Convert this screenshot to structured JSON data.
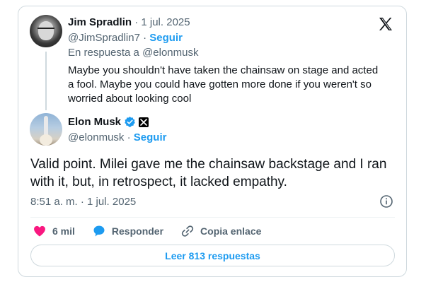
{
  "reply_tweet": {
    "author_name": "Jim Spradlin",
    "separator": "·",
    "date": "1 jul. 2025",
    "handle": "@JimSpradlin7",
    "follow_label": "Seguir",
    "in_reply_to": "En respuesta a @elonmusk",
    "text": "Maybe you shouldn't have taken the chainsaw on stage and acted a fool. Maybe you could have gotten more done if you weren't so worried about looking cool"
  },
  "main_tweet": {
    "author_name": "Elon Musk",
    "handle": "@elonmusk",
    "separator": "·",
    "follow_label": "Seguir",
    "text": "Valid point. Milei gave me the chainsaw backstage and I ran with it, but, in retrospect, it lacked empathy.",
    "timestamp": "8:51 a. m. · 1 jul. 2025"
  },
  "actions": {
    "likes_count": "6 mil",
    "reply_label": "Responder",
    "copy_link_label": "Copia enlace"
  },
  "read_replies_label": "Leer 813 respuestas",
  "icons": {
    "brand": "x-logo-icon",
    "verified": "verified-badge-icon",
    "affiliate": "x-affiliate-badge-icon",
    "info": "info-icon",
    "like": "heart-icon",
    "reply": "speech-bubble-icon",
    "copy_link": "link-icon"
  },
  "colors": {
    "accent": "#1d9bf0",
    "like": "#f91880",
    "muted_text": "#536471",
    "text": "#0f1419",
    "border": "#cfd9de"
  }
}
